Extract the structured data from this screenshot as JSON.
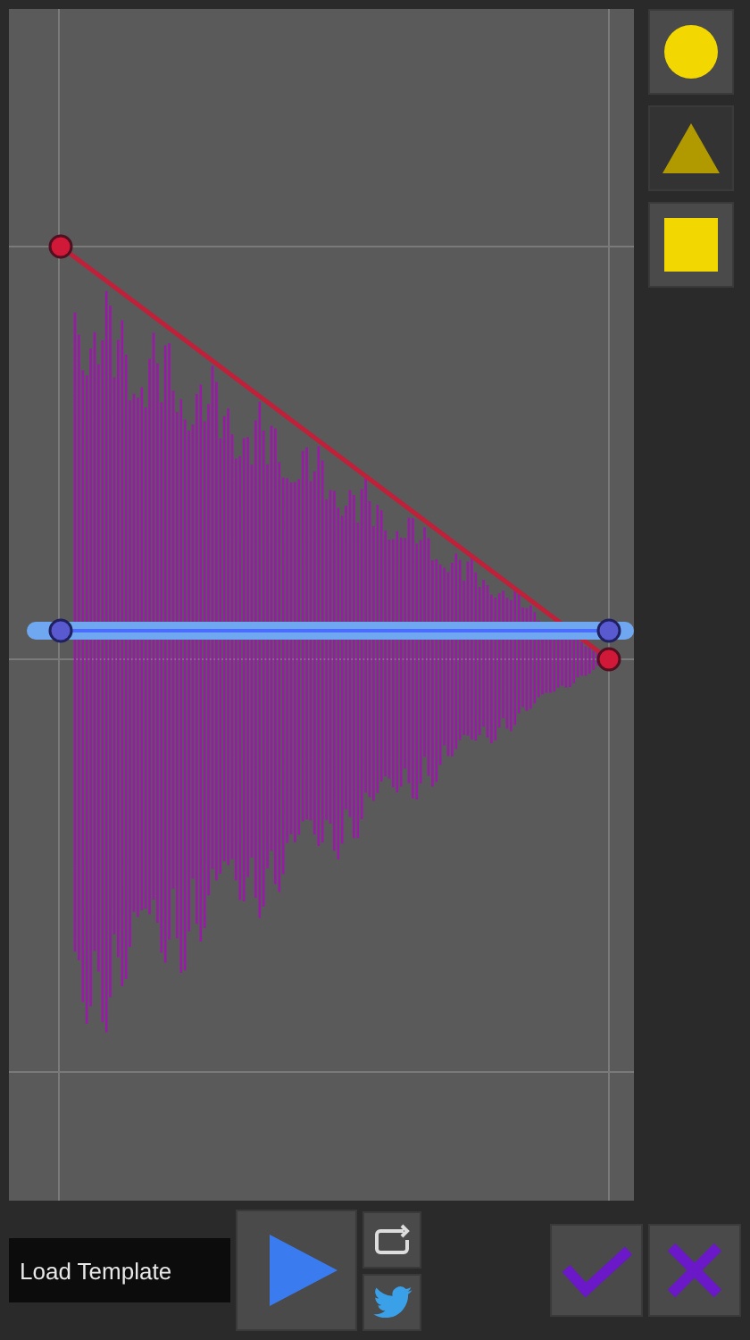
{
  "shapes": [
    {
      "kind": "circle",
      "selected": false
    },
    {
      "kind": "triangle",
      "selected": true
    },
    {
      "kind": "square",
      "selected": false
    }
  ],
  "load_template": {
    "label": "Load Template"
  }
}
